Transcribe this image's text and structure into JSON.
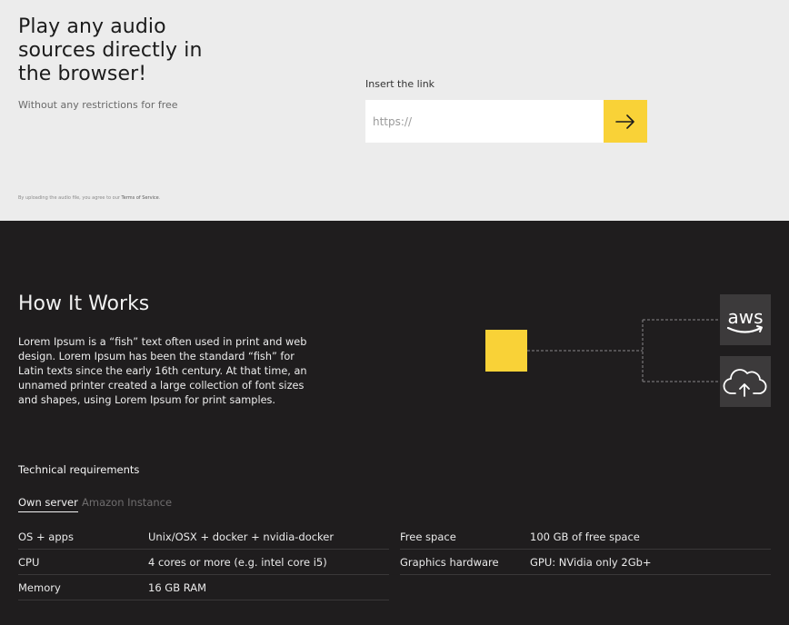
{
  "hero": {
    "title": "Play any audio sources directly in the browser!",
    "subtitle": "Without any restrictions for free",
    "terms_prefix": "By uploading the audio file, you agree to our ",
    "terms_link": "Terms of Service",
    "terms_suffix": "."
  },
  "link_form": {
    "label": "Insert the link",
    "placeholder": "https://",
    "submit_icon": "arrow-right-icon",
    "accent": "#f9d237"
  },
  "how_it_works": {
    "title": "How It Works",
    "description": "Lorem Ipsum is a “fish” text often used in print and web design. Lorem Ipsum has been the standard “fish” for Latin texts since the early 16th century. At that time, an unnamed printer created a large collection of font sizes and shapes, using Lorem Ipsum for print samples.",
    "aws_label": "aws",
    "cloud_icon": "cloud-upload-icon"
  },
  "tech": {
    "title": "Technical requirements",
    "tabs": [
      "Own server",
      "Amazon Instance"
    ],
    "active_tab": "Own server",
    "left_rows": [
      {
        "key": "OS + apps",
        "value": "Unix/OSX + docker + nvidia-docker"
      },
      {
        "key": "CPU",
        "value": "4 cores or more (e.g. intel core i5)"
      },
      {
        "key": "Memory",
        "value": "16 GB RAM"
      }
    ],
    "right_rows": [
      {
        "key": "Free space",
        "value": "100 GB of free space"
      },
      {
        "key": "Graphics hardware",
        "value": "GPU: NVidia only 2Gb+"
      }
    ]
  },
  "colors": {
    "dark_bg": "#1f1d1e",
    "light_bg": "#ececec",
    "accent": "#f9d237",
    "tile_bg": "#3c3a3b"
  }
}
